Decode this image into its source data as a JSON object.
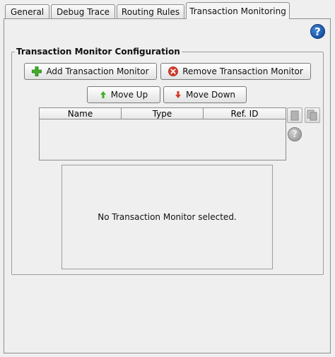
{
  "tabs": [
    {
      "label": "General"
    },
    {
      "label": "Debug Trace"
    },
    {
      "label": "Routing Rules"
    },
    {
      "label": "Transaction Monitoring",
      "active": true
    }
  ],
  "help_icon": "?",
  "group": {
    "title": "Transaction Monitor Configuration"
  },
  "buttons": {
    "add": "Add Transaction Monitor",
    "remove": "Remove Transaction Monitor",
    "move_up": "Move Up",
    "move_down": "Move Down"
  },
  "table": {
    "columns": [
      "Name",
      "Type",
      "Ref. ID"
    ],
    "rows": []
  },
  "side_help_icon": "?",
  "detail": {
    "empty_message": "No Transaction Monitor selected."
  },
  "colors": {
    "add_icon": "#3fae2a",
    "remove_icon": "#d63b2a",
    "help_icon": "#1d5fb8"
  },
  "icons": {
    "add": "plus-icon",
    "remove": "remove-icon",
    "move_up": "arrow-up-icon",
    "move_down": "arrow-down-icon",
    "copy": "copy-icon",
    "paste": "paste-icon",
    "help": "help-icon"
  }
}
